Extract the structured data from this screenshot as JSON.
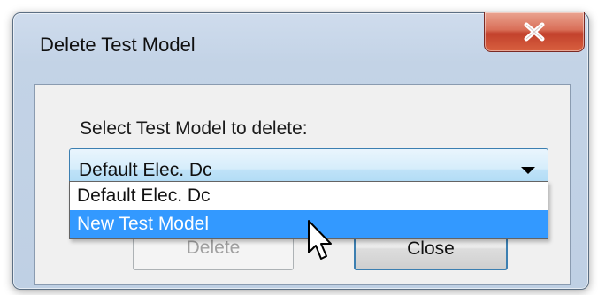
{
  "window": {
    "title": "Delete Test Model"
  },
  "dialog": {
    "prompt": "Select Test Model to delete:",
    "combo": {
      "selected": "Default Elec. Dc"
    },
    "options": [
      {
        "label": "Default Elec. Dc",
        "highlighted": false
      },
      {
        "label": "New Test Model",
        "highlighted": true
      }
    ],
    "buttons": {
      "delete": "Delete",
      "close": "Close"
    }
  },
  "icons": {
    "close": "close-x-icon",
    "dropdown": "chevron-down-icon",
    "cursor": "mouse-pointer-icon"
  },
  "colors": {
    "highlight": "#3399ff",
    "close_button": "#c7452f",
    "combo_border": "#3c7fb1"
  }
}
